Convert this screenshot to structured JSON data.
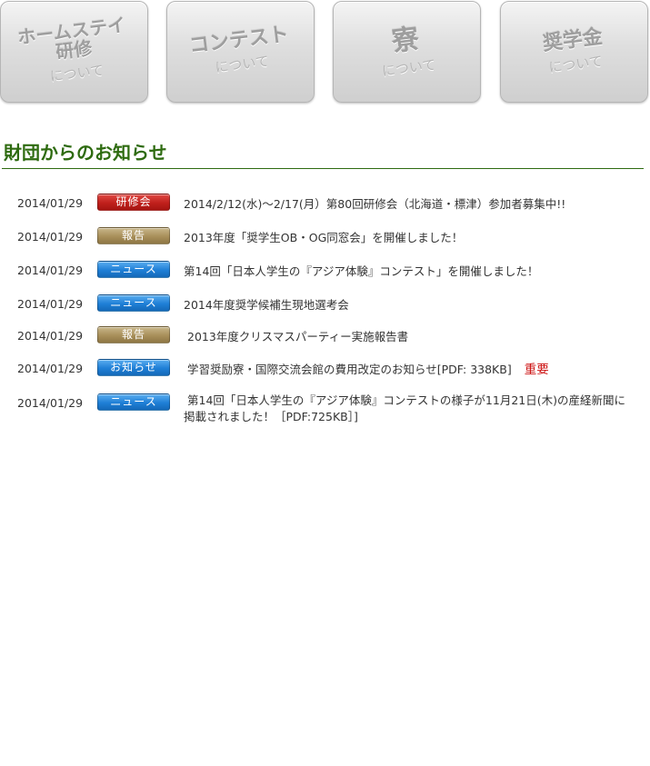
{
  "tiles": [
    {
      "title_lines": [
        "ホームステイ",
        "研修"
      ],
      "sub": "について"
    },
    {
      "title_lines": [
        "コンテスト"
      ],
      "sub": "について"
    },
    {
      "title_lines": [
        "寮"
      ],
      "sub": "について"
    },
    {
      "title_lines": [
        "奨学金"
      ],
      "sub": "について"
    }
  ],
  "news": {
    "heading": "財団からのお知らせ",
    "items": [
      {
        "date": "2014/01/29",
        "badge": "研修会",
        "badge_type": "seminar",
        "title": "2014/2/12(水)～2/17(月）第80回研修会（北海道・標津）参加者募集中!!"
      },
      {
        "date": "2014/01/29",
        "badge": "報告",
        "badge_type": "report",
        "title": "2013年度「奨学生OB・OG同窓会」を開催しました！"
      },
      {
        "date": "2014/01/29",
        "badge": "ニュース",
        "badge_type": "news",
        "title": "第14回「日本人学生の『アジア体験』コンテスト」を開催しました！"
      },
      {
        "date": "2014/01/29",
        "badge": "ニュース",
        "badge_type": "news",
        "title": "2014年度奨学候補生現地選考会"
      },
      {
        "date": "2014/01/29",
        "badge": "報告",
        "badge_type": "report",
        "title": "2013年度クリスマスパーティー実施報告書"
      },
      {
        "date": "2014/01/29",
        "badge": "お知らせ",
        "badge_type": "notice",
        "title": "学習奨励寮・国際交流会館の費用改定のお知らせ[PDF: 338KB]",
        "tag": "重要"
      },
      {
        "date": "2014/01/29",
        "badge": "ニュース",
        "badge_type": "news",
        "title": "第14回「日本人学生の『アジア体験』コンテストの様子が11月21日(木)の産経新聞に掲載されました！［PDF:725KB］]"
      }
    ]
  },
  "colors": {
    "heading": "#2e6b10",
    "badge_seminar": "#c0201c",
    "badge_report": "#a88f5a",
    "badge_news": "#1f7fd6",
    "important": "#cc1111"
  }
}
